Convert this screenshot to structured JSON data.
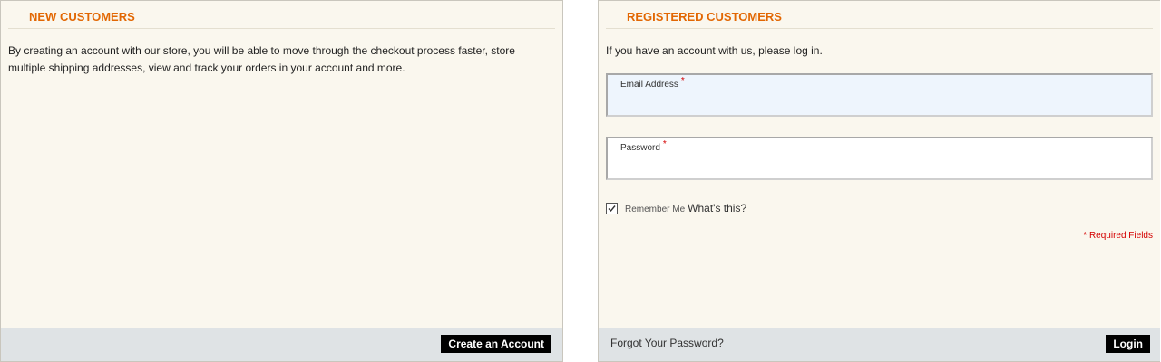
{
  "new_customers": {
    "title": "NEW CUSTOMERS",
    "description": "By creating an account with our store, you will be able to move through the checkout process faster, store multiple shipping addresses, view and track your orders in your account and more.",
    "create_account_label": "Create an Account"
  },
  "registered_customers": {
    "title": "REGISTERED CUSTOMERS",
    "intro": "If you have an account with us, please log in.",
    "email_label": "Email Address",
    "email_value": "",
    "password_label": "Password",
    "password_value": "",
    "required_marker": "*",
    "remember_me_label": "Remember Me",
    "remember_me_checked": true,
    "whats_this_label": "What's this?",
    "required_fields_note": "* Required Fields",
    "forgot_password_label": "Forgot Your Password?",
    "login_label": "Login"
  },
  "colors": {
    "accent": "#e26703",
    "panel_bg": "#faf7ee",
    "footer_bg": "#dfe3e5",
    "required": "#d40000",
    "button_bg": "#000000"
  }
}
